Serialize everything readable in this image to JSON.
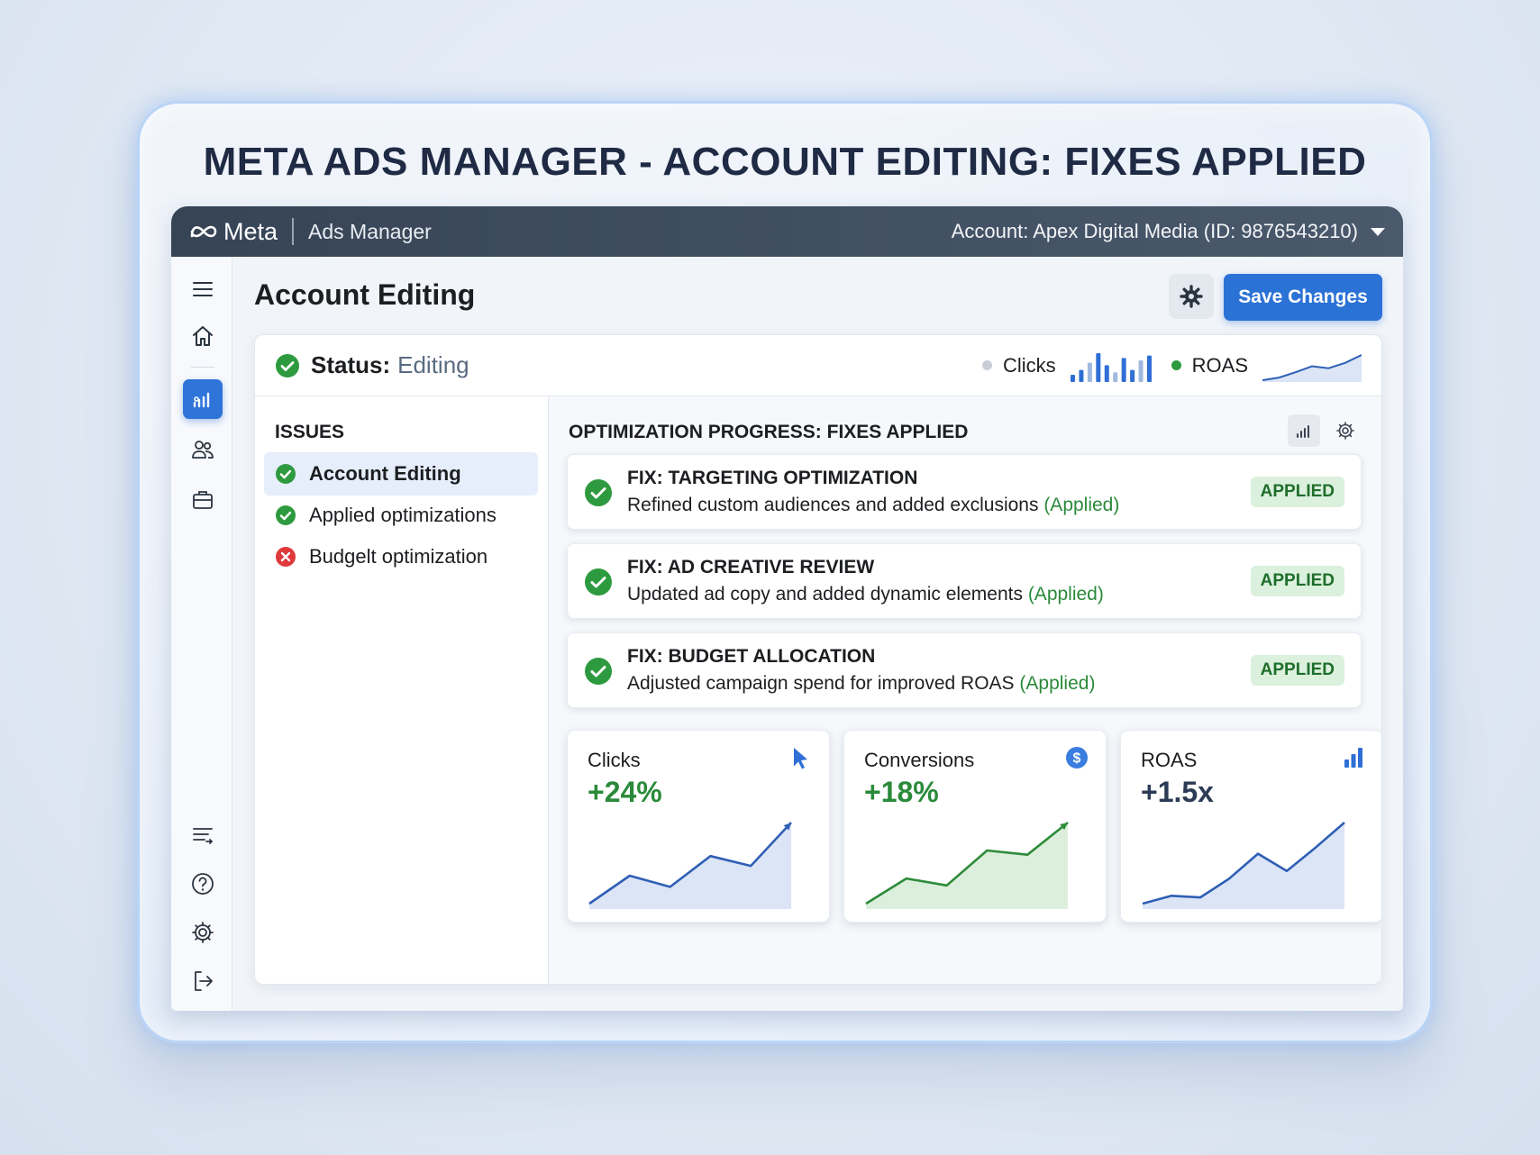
{
  "page": {
    "headline": "META ADS MANAGER - ACCOUNT EDITING: FIXES APPLIED"
  },
  "topbar": {
    "brand": "Meta",
    "app_name": "Ads Manager",
    "account_label": "Account: Apex Digital Media (ID: 9876543210)",
    "logo_icon": "meta-infinity-icon"
  },
  "sidebar": {
    "items": [
      {
        "icon": "menu-icon"
      },
      {
        "icon": "home-icon"
      },
      {
        "icon": "analytics-icon",
        "active": true
      },
      {
        "icon": "audiences-icon"
      },
      {
        "icon": "briefcase-icon"
      },
      {
        "icon": "filter-list-icon"
      },
      {
        "icon": "help-icon"
      },
      {
        "icon": "settings-icon"
      },
      {
        "icon": "logout-icon"
      }
    ]
  },
  "header": {
    "title": "Account Editing",
    "save_label": "Save Changes",
    "settings_icon": "gear-icon"
  },
  "status": {
    "label": "Status:",
    "value": "Editing",
    "mini_clicks_label": "Clicks",
    "mini_roas_label": "ROAS",
    "mini_clicks_bars": [
      3,
      5,
      8,
      12,
      7,
      4,
      10,
      5,
      9,
      11
    ],
    "mini_roas_line": [
      2,
      2.4,
      3.2,
      4.1,
      3.8,
      4.6,
      5.8
    ]
  },
  "issues": {
    "heading": "ISSUES",
    "items": [
      {
        "label": "Account Editing",
        "state": "ok",
        "active": true
      },
      {
        "label": "Applied optimizations",
        "state": "ok",
        "active": false
      },
      {
        "label": "Budgelt optimization",
        "state": "error",
        "active": false
      }
    ]
  },
  "optimization": {
    "heading": "OPTIMIZATION PROGRESS: FIXES APPLIED",
    "fixes": [
      {
        "title": "FIX: TARGETING OPTIMIZATION",
        "description": "Refined custom audiences and added exclusions",
        "applied_note": "(Applied)",
        "badge": "APPLIED"
      },
      {
        "title": "FIX: AD CREATIVE REVIEW",
        "description": "Updated ad copy and added dynamic elements",
        "applied_note": "(Applied)",
        "badge": "APPLIED"
      },
      {
        "title": "FIX: BUDGET ALLOCATION",
        "description": "Adjusted campaign spend for improved ROAS",
        "applied_note": "(Applied)",
        "badge": "APPLIED"
      }
    ]
  },
  "metrics": [
    {
      "label": "Clicks",
      "value": "+24%",
      "value_color": "#2a8a3a",
      "icon": "cursor-icon",
      "line_color": "#2f5fb5",
      "fill_color": "#dbe5f6",
      "trend": [
        1,
        3,
        2.2,
        4.4,
        3.7,
        6.8
      ]
    },
    {
      "label": "Conversions",
      "value": "+18%",
      "value_color": "#2a8a3a",
      "icon": "dollar-icon",
      "line_color": "#2e8b3a",
      "fill_color": "#dcefdd",
      "trend": [
        1,
        2.8,
        2.3,
        4.8,
        4.5,
        6.8
      ]
    },
    {
      "label": "ROAS",
      "value": "+1.5x",
      "value_color": "#2b3b55",
      "icon": "bar-chart-icon",
      "line_color": "#2f5fb5",
      "fill_color": "#dbe5f6",
      "trend": [
        1,
        1.5,
        1.4,
        2.6,
        4.2,
        3.1,
        4.6,
        6.2
      ]
    }
  ]
}
